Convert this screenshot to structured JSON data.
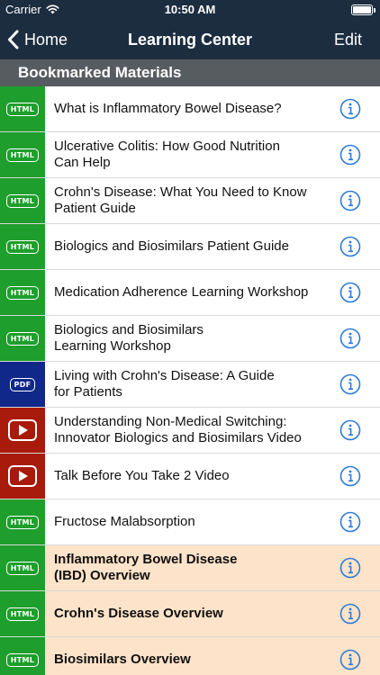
{
  "status_bar": {
    "carrier": "Carrier",
    "time": "10:50 AM",
    "battery_percent": 100
  },
  "nav": {
    "back_label": "Home",
    "title": "Learning Center",
    "edit_label": "Edit"
  },
  "section": {
    "title": "Bookmarked Materials"
  },
  "colors": {
    "header": "#1c2d40",
    "section": "#575c61",
    "html": "#1e9e2c",
    "pdf": "#10288a",
    "video": "#a81a0a",
    "featured": "#fde3c9",
    "info": "#2d7ad6"
  },
  "items": [
    {
      "type": "HTML",
      "title": "What is Inflammatory Bowel Disease?",
      "featured": false
    },
    {
      "type": "HTML",
      "title": "Ulcerative Colitis: How Good Nutrition\nCan Help",
      "featured": false
    },
    {
      "type": "HTML",
      "title": "Crohn's Disease: What You Need to Know\nPatient Guide",
      "featured": false
    },
    {
      "type": "HTML",
      "title": "Biologics and Biosimilars Patient Guide",
      "featured": false
    },
    {
      "type": "HTML",
      "title": "Medication Adherence Learning Workshop",
      "featured": false
    },
    {
      "type": "HTML",
      "title": "Biologics and Biosimilars\nLearning Workshop",
      "featured": false
    },
    {
      "type": "PDF",
      "title": "Living with Crohn's Disease: A Guide\nfor Patients",
      "featured": false
    },
    {
      "type": "VIDEO",
      "title": "Understanding Non-Medical Switching:\nInnovator Biologics and Biosimilars Video",
      "featured": false
    },
    {
      "type": "VIDEO",
      "title": "Talk Before You Take 2 Video",
      "featured": false
    },
    {
      "type": "HTML",
      "title": "Fructose Malabsorption",
      "featured": false
    },
    {
      "type": "HTML",
      "title": "Inflammatory Bowel Disease\n(IBD) Overview",
      "featured": true
    },
    {
      "type": "HTML",
      "title": "Crohn's Disease Overview",
      "featured": true
    },
    {
      "type": "HTML",
      "title": "Biosimilars Overview",
      "featured": true
    }
  ]
}
